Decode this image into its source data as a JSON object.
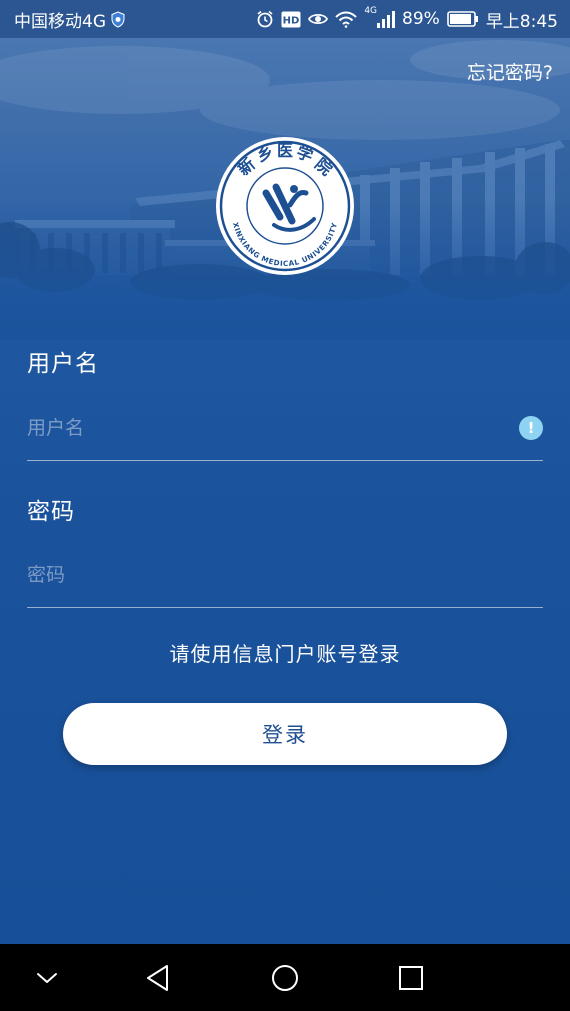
{
  "status_bar": {
    "carrier": "中国移动4G",
    "network_badge": "4G",
    "battery_percent": "89%",
    "time": "早上8:45",
    "icons": [
      "shield-icon",
      "alarm-icon",
      "hd-icon",
      "eye-icon",
      "wifi-icon",
      "signal-icon",
      "battery-icon"
    ]
  },
  "header": {
    "forgot_password": "忘记密码?"
  },
  "logo": {
    "chinese_name": "新乡医学院",
    "english_name": "XINXIANG MEDICAL UNIVERSITY"
  },
  "form": {
    "username": {
      "label": "用户名",
      "placeholder": "用户名",
      "value": ""
    },
    "password": {
      "label": "密码",
      "placeholder": "密码",
      "value": ""
    },
    "hint": "请使用信息门户账号登录",
    "login_button": "登录"
  },
  "nav_bar": {
    "buttons": [
      "chevron-down-icon",
      "back-icon",
      "home-icon",
      "recents-icon"
    ]
  },
  "colors": {
    "background_top": "#4f7bb4",
    "background_bottom": "#174f98",
    "button_text": "#1f4f93",
    "alert": "#8fd3f3"
  }
}
